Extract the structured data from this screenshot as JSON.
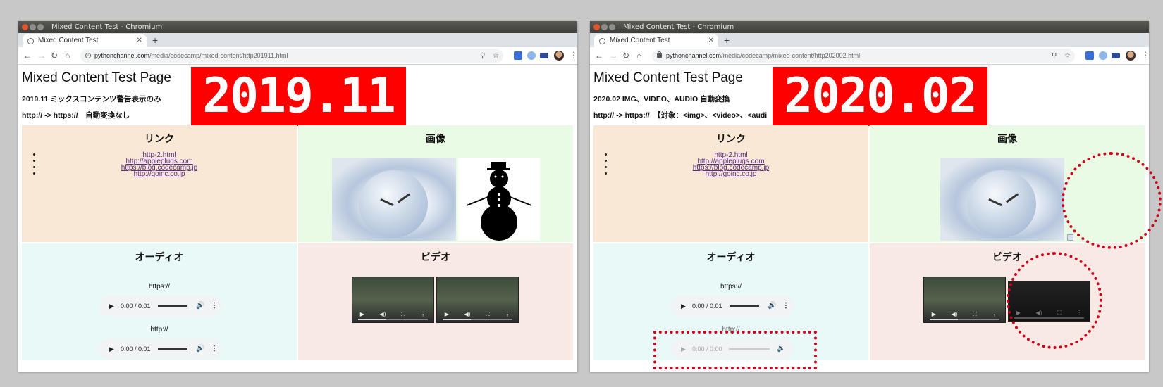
{
  "colors": {
    "date_badge": "#ff0000",
    "annotation": "#d0021b"
  },
  "left": {
    "window_title": "Mixed Content Test - Chromium",
    "tab_title": "Mixed Content Test",
    "url_host": "pythonchannel.com",
    "url_path": "/media/codecamp/mixed-content/http201911.html",
    "page_title": "Mixed Content Test Page",
    "badge": "2019.11",
    "subtitle1": "2019.11 ミックスコンテンツ警告表示のみ",
    "subtitle2": "http:// -> https://　自動変換なし",
    "link_heading": "リンク",
    "links": [
      "http-2.html",
      "http://appleplugs.com",
      "https://blog.codecamp.jp",
      "http://goinc.co.jp"
    ],
    "image_heading": "画像",
    "audio_heading": "オーディオ",
    "audio_label1": "https://",
    "audio_time1": "0:00 / 0:01",
    "audio_label2": "http://",
    "audio_time2": "0:00 / 0:01",
    "video_heading": "ビデオ"
  },
  "right": {
    "window_title": "Mixed Content Test - Chromium",
    "tab_title": "Mixed Content Test",
    "url_host": "pythonchannel.com",
    "url_path": "/media/codecamp/mixed-content/http202002.html",
    "page_title": "Mixed Content Test Page",
    "badge": "2020.02",
    "subtitle1": "2020.02 IMG、VIDEO、AUDIO 自動変換",
    "subtitle2": "http:// -> https://　【対象：<img>、<video>、<audi",
    "link_heading": "リンク",
    "links": [
      "http-2.html",
      "http://appleplugs.com",
      "https://blog.codecamp.jp",
      "http://goinc.co.jp"
    ],
    "image_heading": "画像",
    "audio_heading": "オーディオ",
    "audio_label1": "https://",
    "audio_time1": "0:00 / 0:01",
    "audio_label2": "http://",
    "audio_time2": "0:00 / 0:00",
    "video_heading": "ビデオ"
  }
}
